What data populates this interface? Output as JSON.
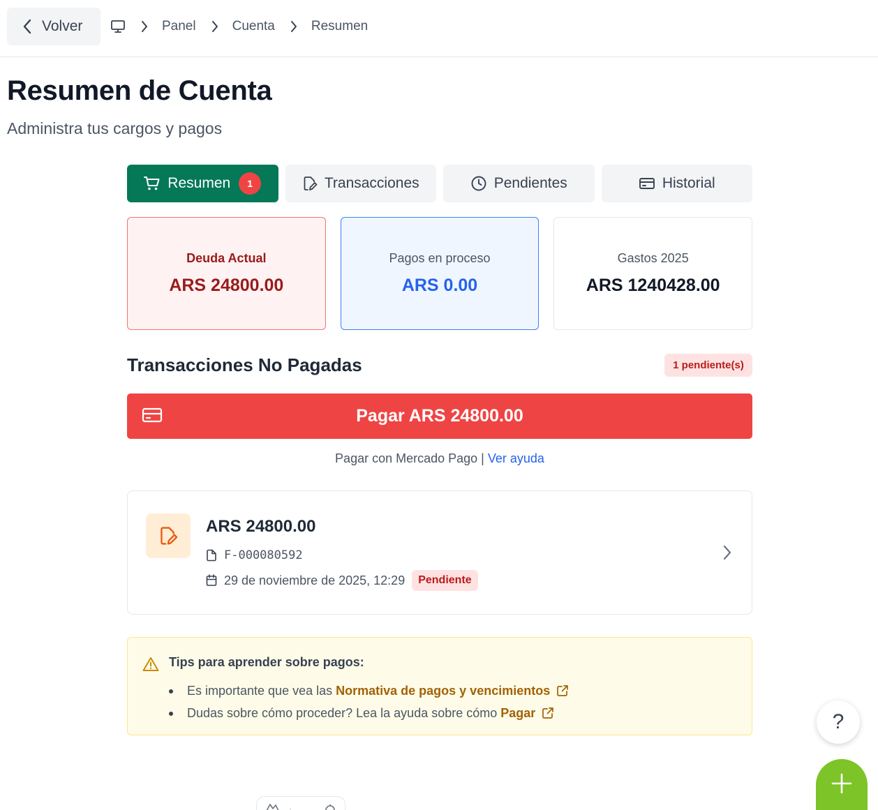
{
  "header": {
    "back_label": "Volver",
    "breadcrumbs": [
      "Panel",
      "Cuenta",
      "Resumen"
    ]
  },
  "page": {
    "title": "Resumen de Cuenta",
    "subtitle": "Administra tus cargos y pagos"
  },
  "tabs": [
    {
      "label": "Resumen",
      "icon": "cart-icon",
      "active": true,
      "badge": "1"
    },
    {
      "label": "Transacciones",
      "icon": "document-edit-icon",
      "active": false
    },
    {
      "label": "Pendientes",
      "icon": "clock-icon",
      "active": false
    },
    {
      "label": "Historial",
      "icon": "credit-card-icon",
      "active": false
    }
  ],
  "summary": {
    "debt": {
      "label": "Deuda Actual",
      "value": "ARS 24800.00"
    },
    "processing": {
      "label": "Pagos en proceso",
      "value": "ARS 0.00"
    },
    "spending": {
      "label": "Gastos 2025",
      "value": "ARS 1240428.00"
    }
  },
  "unpaid": {
    "title": "Transacciones No Pagadas",
    "badge": "1 pendiente(s)",
    "pay_button": "Pagar ARS 24800.00",
    "pay_note": "Pagar con Mercado Pago |",
    "help_link": "Ver ayuda"
  },
  "transaction": {
    "amount": "ARS 24800.00",
    "reference": "F-000080592",
    "date": "29 de noviembre de 2025, 12:29",
    "status": "Pendiente"
  },
  "tips": {
    "title": "Tips para aprender sobre pagos:",
    "items": [
      {
        "text": "Es importante que vea las",
        "link": "Normativa de pagos y vencimientos"
      },
      {
        "text": "Dudas sobre cómo proceder? Lea la ayuda sobre cómo",
        "link": "Pagar"
      }
    ]
  },
  "fabs": {
    "help": "?"
  },
  "colors": {
    "primary_green": "#047857",
    "danger_red": "#ef4444",
    "info_blue": "#2563eb",
    "fab_green": "#7cc427",
    "tip_link": "#a16207"
  }
}
